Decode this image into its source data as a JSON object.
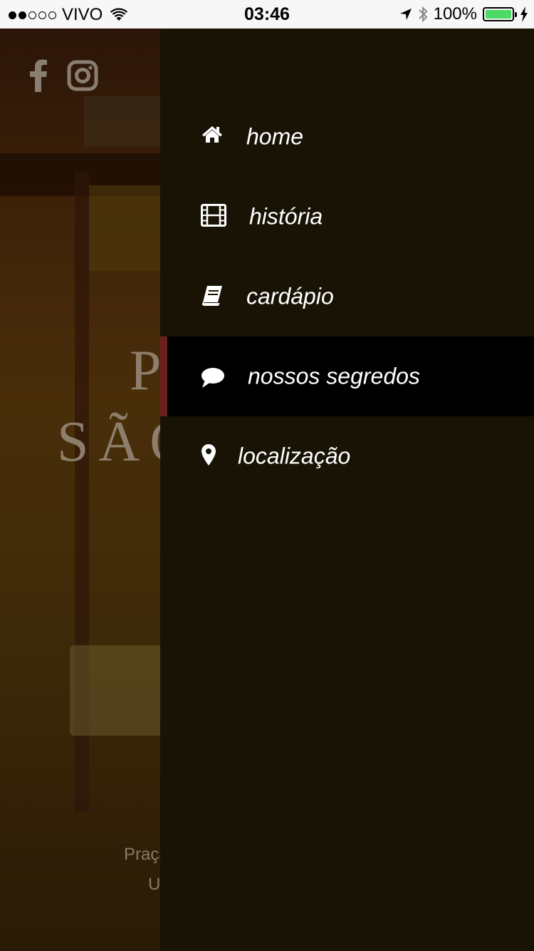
{
  "status_bar": {
    "carrier": "VIVO",
    "time": "03:46",
    "battery": "100%",
    "signal_bars_filled": 2,
    "signal_bars_total": 5,
    "battery_color": "#4cd964"
  },
  "background_page": {
    "title_line1": "P",
    "title_line2": "SÃO",
    "address_line1": "Praça",
    "address_line2": "U",
    "social_icons": [
      "facebook-icon",
      "instagram-icon"
    ]
  },
  "drawer": {
    "background_color": "#181305",
    "active_color": "#000000",
    "active_indicator_color": "#6b1f1a",
    "items": [
      {
        "label": "home",
        "icon": "home-icon",
        "active": false
      },
      {
        "label": "história",
        "icon": "film-icon",
        "active": false
      },
      {
        "label": "cardápio",
        "icon": "book-icon",
        "active": false
      },
      {
        "label": "nossos segredos",
        "icon": "comment-icon",
        "active": true
      },
      {
        "label": "localização",
        "icon": "map-marker-icon",
        "active": false
      }
    ]
  }
}
